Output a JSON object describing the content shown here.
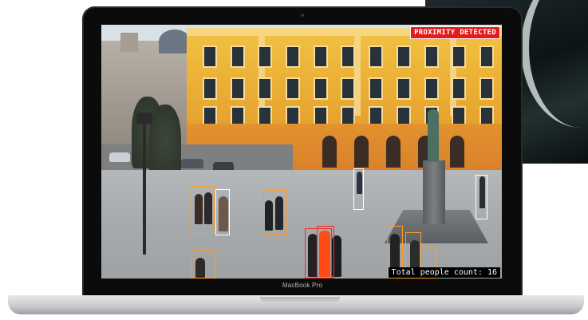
{
  "laptop": {
    "brand_label": "MacBook Pro"
  },
  "video_feed": {
    "alert_label": "PROXIMITY DETECTED",
    "people_count_label": "Total people count: 16"
  },
  "colors": {
    "alert_bg": "#e31b1b",
    "box_safe": "#ffffff",
    "box_warning": "#ff9a2b",
    "box_violation": "#ff2525"
  }
}
